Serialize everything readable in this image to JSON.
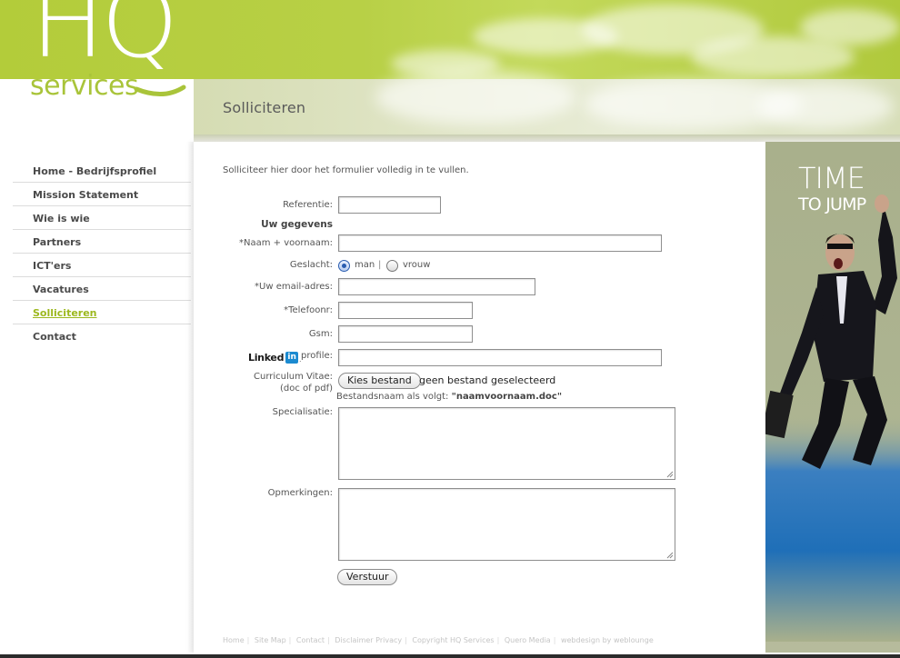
{
  "brand": {
    "logo_hq": "HQ",
    "logo_services": "services",
    "green": "#b3cc3a"
  },
  "page": {
    "title": "Solliciteren",
    "intro": "Solliciteer hier door het formulier volledig in te vullen."
  },
  "nav": {
    "items": [
      {
        "label": "Home - Bedrijfsprofiel",
        "active": false
      },
      {
        "label": "Mission Statement",
        "active": false
      },
      {
        "label": "Wie is wie",
        "active": false
      },
      {
        "label": "Partners",
        "active": false
      },
      {
        "label": "ICT'ers",
        "active": false
      },
      {
        "label": "Vacatures",
        "active": false
      },
      {
        "label": "Solliciteren",
        "active": true
      },
      {
        "label": "Contact",
        "active": false
      }
    ]
  },
  "form": {
    "referentie_label": "Referentie:",
    "referentie_value": "",
    "section_title": "Uw gegevens",
    "naam_label": "*Naam + voornaam:",
    "naam_value": "",
    "geslacht_label": "Geslacht:",
    "geslacht_man": "man",
    "geslacht_sep": "|",
    "geslacht_vrouw": "vrouw",
    "geslacht_selected": "man",
    "email_label": "*Uw email-adres:",
    "email_value": "",
    "telefoon_label": "*Telefoonr:",
    "telefoon_value": "",
    "gsm_label": "Gsm:",
    "gsm_value": "",
    "linkedin_word": "Linked",
    "linkedin_in": "in",
    "linkedin_suffix": ".",
    "linkedin_label": "profile:",
    "linkedin_value": "",
    "cv_label_line1": "Curriculum Vitae:",
    "cv_label_line2": "(doc of pdf)",
    "cv_button": "Kies bestand",
    "cv_status": "geen bestand geselecteerd",
    "cv_hint_prefix": "Bestandsnaam als volgt: ",
    "cv_hint_example": "\"naamvoornaam.doc\"",
    "specialisatie_label": "Specialisatie:",
    "specialisatie_value": "",
    "opmerkingen_label": "Opmerkingen:",
    "opmerkingen_value": "",
    "submit_label": "Verstuur"
  },
  "footer": {
    "links": [
      "Home",
      "Site Map",
      "Contact",
      "Disclaimer Privacy",
      "Copyright HQ Services",
      "Quero Media",
      "webdesign by weblounge"
    ]
  },
  "banner": {
    "line1": "TIME",
    "line2": "TO JUMP"
  }
}
